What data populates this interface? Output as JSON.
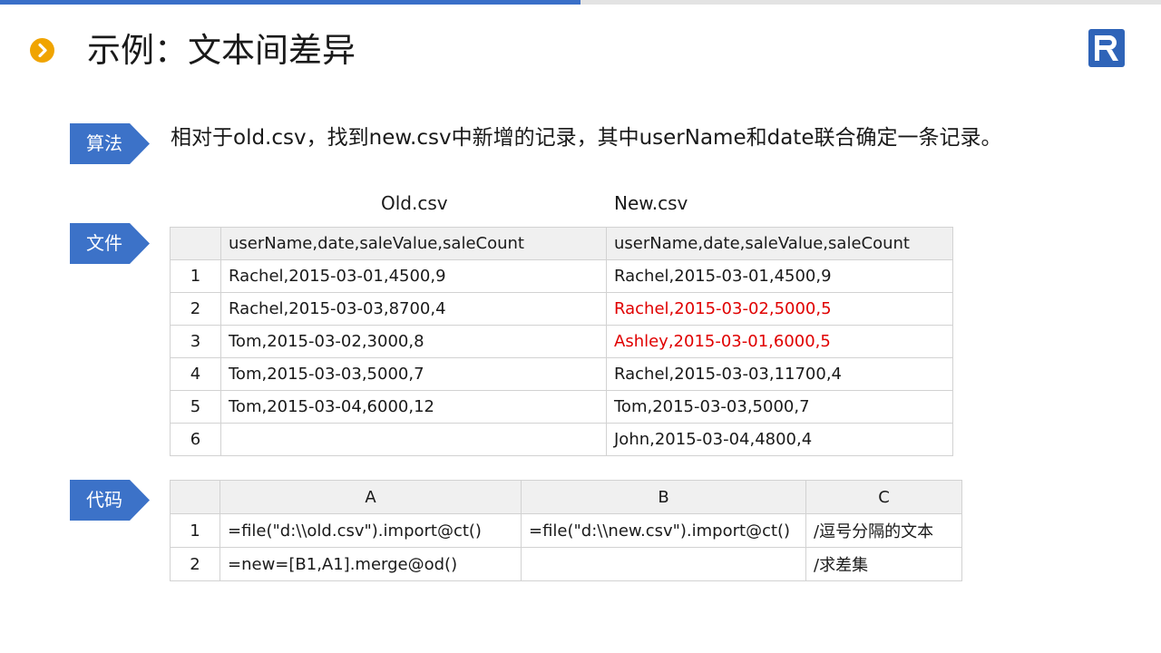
{
  "header": {
    "title": "示例：文本间差异"
  },
  "colors": {
    "accent": "#3c72c8",
    "title_dot": "#f0a400",
    "highlight": "#e00000"
  },
  "algorithm": {
    "label": "算法",
    "text": "相对于old.csv，找到new.csv中新增的记录，其中userName和date联合确定一条记录。"
  },
  "files": {
    "label": "文件",
    "old_title": "Old.csv",
    "new_title": "New.csv",
    "header_old": "userName,date,saleValue,saleCount",
    "header_new": "userName,date,saleValue,saleCount",
    "rows": [
      {
        "n": "1",
        "old": "Rachel,2015-03-01,4500,9",
        "new": "Rachel,2015-03-01,4500,9"
      },
      {
        "n": "2",
        "old": "Rachel,2015-03-03,8700,4",
        "new": "Rachel,2015-03-02,5000,5"
      },
      {
        "n": "3",
        "old": "Tom,2015-03-02,3000,8",
        "new": "Ashley,2015-03-01,6000,5"
      },
      {
        "n": "4",
        "old": "Tom,2015-03-03,5000,7",
        "new": "Rachel,2015-03-03,11700,4"
      },
      {
        "n": "5",
        "old": "Tom,2015-03-04,6000,12",
        "new": "Tom,2015-03-03,5000,7"
      },
      {
        "n": "6",
        "old": "",
        "new": "John,2015-03-04,4800,4"
      }
    ]
  },
  "code": {
    "label": "代码",
    "columns": [
      "A",
      "B",
      "C"
    ],
    "rows": [
      {
        "n": "1",
        "a": "=file(\"d:\\\\old.csv\").import@ct()",
        "b": "=file(\"d:\\\\new.csv\").import@ct()",
        "c": "/逗号分隔的文本"
      },
      {
        "n": "2",
        "a": "=new=[B1,A1].merge@od()",
        "b": "",
        "c": "/求差集"
      }
    ]
  }
}
